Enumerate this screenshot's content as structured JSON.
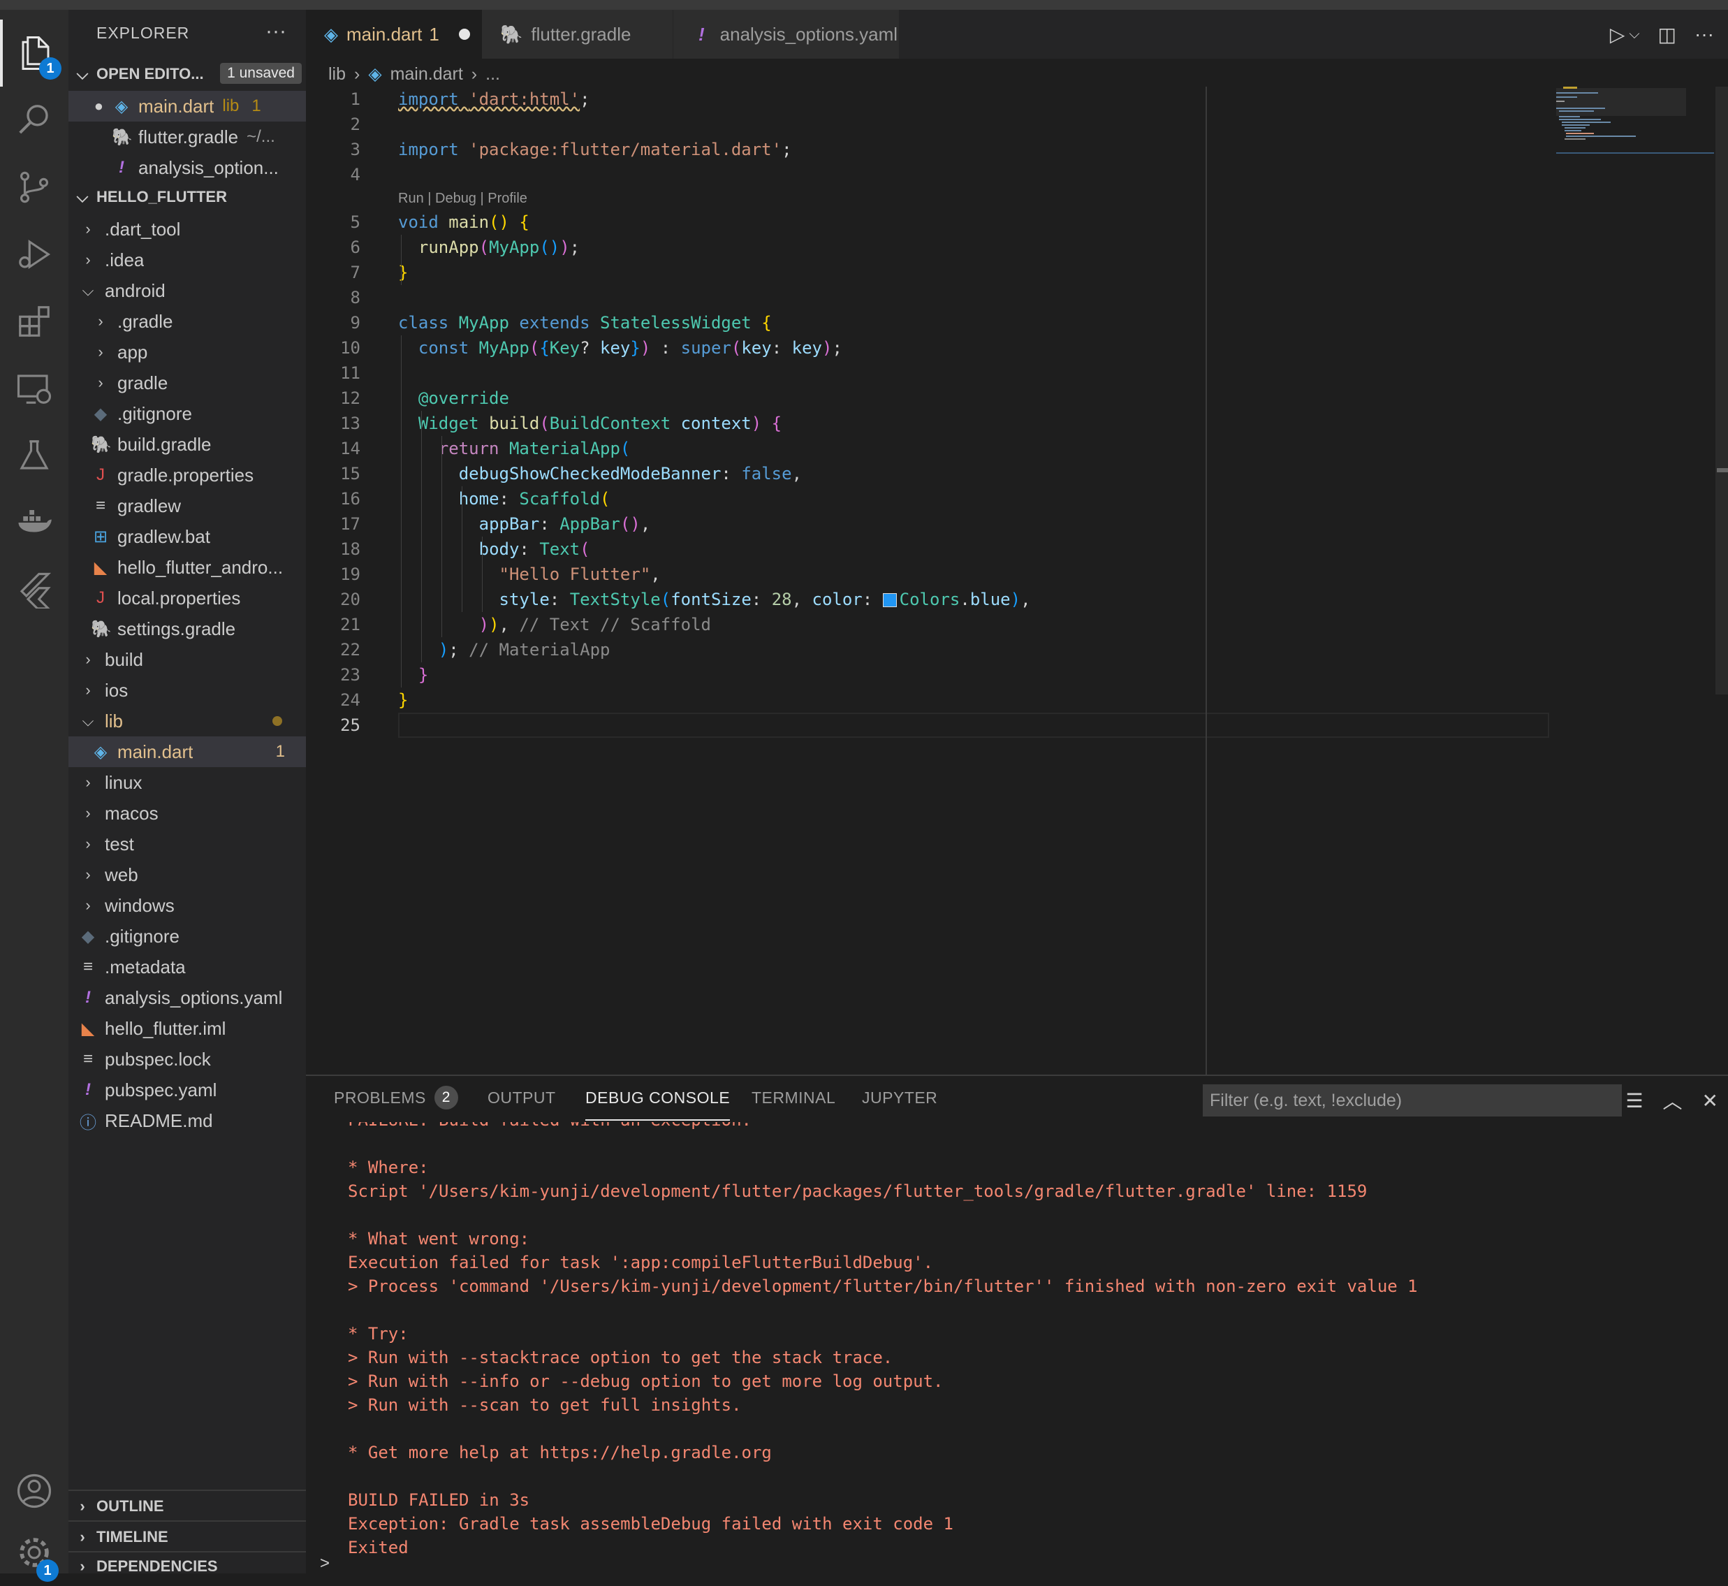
{
  "explorer": {
    "title": "EXPLORER",
    "more": "···",
    "open_editors": {
      "label": "OPEN EDITO...",
      "badge": "1 unsaved",
      "items": [
        {
          "name": "main.dart",
          "desc": "lib",
          "count": "1"
        },
        {
          "name": "flutter.gradle",
          "desc": "~/..."
        },
        {
          "name": "analysis_option..."
        }
      ]
    },
    "project": {
      "label": "HELLO_FLUTTER",
      "items": [
        {
          "name": ".dart_tool"
        },
        {
          "name": ".idea"
        },
        {
          "name": "android"
        },
        {
          "name": ".gradle"
        },
        {
          "name": "app"
        },
        {
          "name": "gradle"
        },
        {
          "name": ".gitignore"
        },
        {
          "name": "build.gradle"
        },
        {
          "name": "gradle.properties"
        },
        {
          "name": "gradlew"
        },
        {
          "name": "gradlew.bat"
        },
        {
          "name": "hello_flutter_andro..."
        },
        {
          "name": "local.properties"
        },
        {
          "name": "settings.gradle"
        },
        {
          "name": "build"
        },
        {
          "name": "ios"
        },
        {
          "name": "lib"
        },
        {
          "name": "main.dart",
          "count": "1"
        },
        {
          "name": "linux"
        },
        {
          "name": "macos"
        },
        {
          "name": "test"
        },
        {
          "name": "web"
        },
        {
          "name": "windows"
        },
        {
          "name": ".gitignore"
        },
        {
          "name": ".metadata"
        },
        {
          "name": "analysis_options.yaml"
        },
        {
          "name": "hello_flutter.iml"
        },
        {
          "name": "pubspec.lock"
        },
        {
          "name": "pubspec.yaml"
        },
        {
          "name": "README.md"
        }
      ]
    },
    "outline": "OUTLINE",
    "timeline": "TIMELINE",
    "dependencies": "DEPENDENCIES"
  },
  "activity": {
    "explorer_badge": "1",
    "settings_badge": "1"
  },
  "tabs": [
    {
      "label": "main.dart",
      "count": "1"
    },
    {
      "label": "flutter.gradle"
    },
    {
      "label": "analysis_options.yaml"
    }
  ],
  "breadcrumb": {
    "folder": "lib",
    "file": "main.dart",
    "more": "..."
  },
  "editor": {
    "line_numbers": [
      "1",
      "2",
      "3",
      "4",
      "5",
      "6",
      "7",
      "8",
      "9",
      "10",
      "11",
      "12",
      "13",
      "14",
      "15",
      "16",
      "17",
      "18",
      "19",
      "20",
      "21",
      "22",
      "23",
      "24",
      "25"
    ],
    "codelens": "Run | Debug | Profile",
    "lines": [
      "import 'dart:html';",
      "",
      "import 'package:flutter/material.dart';",
      "",
      "void main() {",
      "  runApp(MyApp());",
      "}",
      "",
      "class MyApp extends StatelessWidget {",
      "  const MyApp({Key? key}) : super(key: key);",
      "",
      "  @override",
      "  Widget build(BuildContext context) {",
      "    return MaterialApp(",
      "      debugShowCheckedModeBanner: false,",
      "      home: Scaffold(",
      "        appBar: AppBar(),",
      "        body: Text(",
      "          \"Hello Flutter\",",
      "          style: TextStyle(fontSize: 28, color: Colors.blue),",
      "        )), // Text // Scaffold",
      "    ); // MaterialApp",
      "  }",
      "}",
      ""
    ]
  },
  "panel": {
    "tabs": [
      {
        "label": "PROBLEMS",
        "count": "2"
      },
      {
        "label": "OUTPUT"
      },
      {
        "label": "DEBUG CONSOLE"
      },
      {
        "label": "TERMINAL"
      },
      {
        "label": "JUPYTER"
      }
    ],
    "filter_placeholder": "Filter (e.g. text, !exclude)",
    "console_lines": [
      "FAILURE: Build failed with an exception.",
      "",
      "* Where:",
      "Script '/Users/kim-yunji/development/flutter/packages/flutter_tools/gradle/flutter.gradle' line: 1159",
      "",
      "* What went wrong:",
      "Execution failed for task ':app:compileFlutterBuildDebug'.",
      "> Process 'command '/Users/kim-yunji/development/flutter/bin/flutter'' finished with non-zero exit value 1",
      "",
      "* Try:",
      "> Run with --stacktrace option to get the stack trace.",
      "> Run with --info or --debug option to get more log output.",
      "> Run with --scan to get full insights.",
      "",
      "* Get more help at https://help.gradle.org",
      "",
      "BUILD FAILED in 3s",
      "Exception: Gradle task assembleDebug failed with exit code 1",
      "Exited"
    ],
    "prompt": ">"
  },
  "colors": {
    "error_text": "#f48771",
    "modified": "#e2c08d",
    "accent_badge": "#0e7ad3"
  }
}
